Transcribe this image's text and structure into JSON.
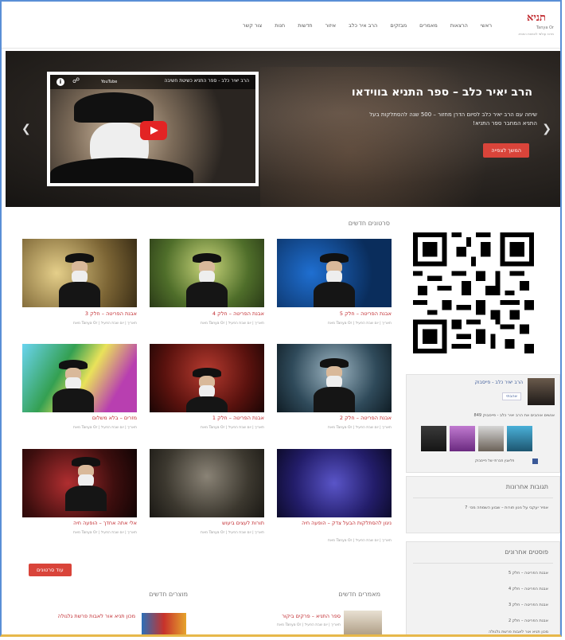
{
  "nav": {
    "logo_mark": "תניא",
    "logo_text": "Tanya Or",
    "logo_sub": "מרכז עולמי להפצת התניא",
    "items": [
      "ראשי",
      "הרצאות",
      "מאמרים",
      "מבזקים",
      "הרב איר כלב",
      "איזור",
      "חדשות",
      "חנות",
      "צור קשר"
    ]
  },
  "hero": {
    "title": "הרב יאיר כלב – ספר התניא בווידאו",
    "desc": "שיחה עם הרב יאיר כלב לסיום הדרן מחזור – 500 שנה להסתלקות בעל התניא המחבר ספר התניא!",
    "button": "המשך לצפייה",
    "video": {
      "title": "הרב יאיר כלב - ספר התניא כשיטת חשיבה",
      "brand": "YouTube"
    }
  },
  "main": {
    "videos_title": "סרטונים חדשים",
    "videos": [
      {
        "caption": "אבנת הפריטה – חלק 5",
        "meta": "מאת Tanya Or | תאריך | יום שבת הפעיל"
      },
      {
        "caption": "אבנת הפריטה – חלק 4",
        "meta": "מאת Tanya Or | תאריך | יום שבת הפעיל"
      },
      {
        "caption": "אבנת הפריטה – חלק 3",
        "meta": "מאת Tanya Or | תאריך | יום שבת הפעיל"
      },
      {
        "caption": "אבנת הפריטה – חלק 2",
        "meta": "מאת Tanya Or | תאריך | יום שבת הפעיל"
      },
      {
        "caption": "אבנת הפריטה – חלק 1",
        "meta": "מאת Tanya Or | תאריך | יום שבת הפעיל"
      },
      {
        "caption": "מזרים – בלא משלום",
        "meta": "מאת Tanya Or | תאריך | יום שבת הפעיל"
      },
      {
        "caption": "ניגון להסתלקות הבעל צדק – הופעה חיה",
        "meta": "מאת Tanya Or | תאריך | יום שבת הפעיל"
      },
      {
        "caption": "תורות לעצים ביעוש",
        "meta": "מאת Tanya Or | תאריך | יום שבת הפעיל"
      },
      {
        "caption": "אלי אתה אחדך – הופעה חיה",
        "meta": "מאת Tanya Or | תאריך | יום שבת הפעיל"
      }
    ],
    "more_button": "עוד סרטונים",
    "articles_title": "מאמרים חדשים",
    "articles_line": "ספר התניא – פרקים ביקור",
    "articles_meta": "מאת Tanya Or | תאריך | יום שבת הפעיל",
    "products_title": "מוצרים חדשים",
    "products_line": "מכון תניא אור לאבות פרשת גלגולה"
  },
  "sidebar": {
    "fb_name": "הרב יאיר כלב - פייסבוק",
    "fb_like": "אהבתי",
    "fb_count": "849 אנשים אוהבים את הרב יאיר כלב - פייסבוק",
    "fb_plugin": "פלאגין חברתי של פייסבוק",
    "recent_comments_title": "תגובות אחרונות",
    "recent_comment": "אמיר יעקבי על ניגון תורות – שבוע השמחה מס׳ 7",
    "recent_posts_title": "פוסטים אחרונים",
    "recent_posts": [
      "אבנת הפריטה – חלק 5",
      "אבנת הפריטה – חלק 4",
      "אבנת הפריטה – חלק 3",
      "אבנת הפריטה – חלק 2",
      "מכון תניא אור לאבות פרשת גלגולה"
    ]
  }
}
